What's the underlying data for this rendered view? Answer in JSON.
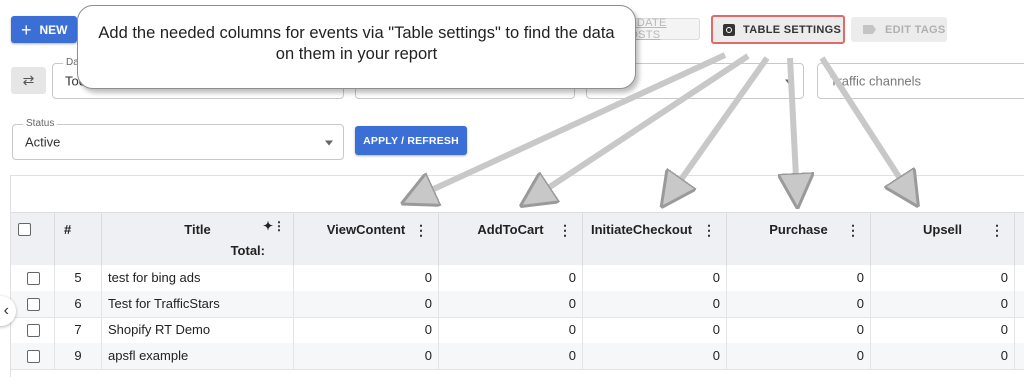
{
  "toolbar": {
    "new_label": "NEW",
    "update_costs_label": "UPDATE COSTS",
    "table_settings_label": "TABLE SETTINGS",
    "edit_tags_label": "EDIT TAGS"
  },
  "callout": {
    "text": "Add the needed columns for events via \"Table settings\" to find the data on them in your report"
  },
  "filters": {
    "date_label": "Date",
    "date_value": "Today",
    "traffic_channels_placeholder": "Traffic channels",
    "status_label": "Status",
    "status_value": "Active",
    "apply_label": "APPLY / REFRESH"
  },
  "table": {
    "columns": {
      "num": "#",
      "title": "Title",
      "total": "Total:",
      "c1": "ViewContent",
      "c2": "AddToCart",
      "c3": "InitiateCheckout",
      "c4": "Purchase",
      "c5": "Upsell"
    },
    "rows": [
      {
        "num": "5",
        "title": "test for bing ads",
        "c1": "0",
        "c2": "0",
        "c3": "0",
        "c4": "0",
        "c5": "0"
      },
      {
        "num": "6",
        "title": "Test for TrafficStars",
        "c1": "0",
        "c2": "0",
        "c3": "0",
        "c4": "0",
        "c5": "0"
      },
      {
        "num": "7",
        "title": "Shopify RT Demo",
        "c1": "0",
        "c2": "0",
        "c3": "0",
        "c4": "0",
        "c5": "0"
      },
      {
        "num": "9",
        "title": "apsfl example",
        "c1": "0",
        "c2": "0",
        "c3": "0",
        "c4": "0",
        "c5": "0"
      }
    ]
  },
  "colors": {
    "primary": "#3b6fd6",
    "highlight_border": "#e06a6a",
    "header_bg": "#eef0f3",
    "arrow": "#c8c8c8"
  }
}
